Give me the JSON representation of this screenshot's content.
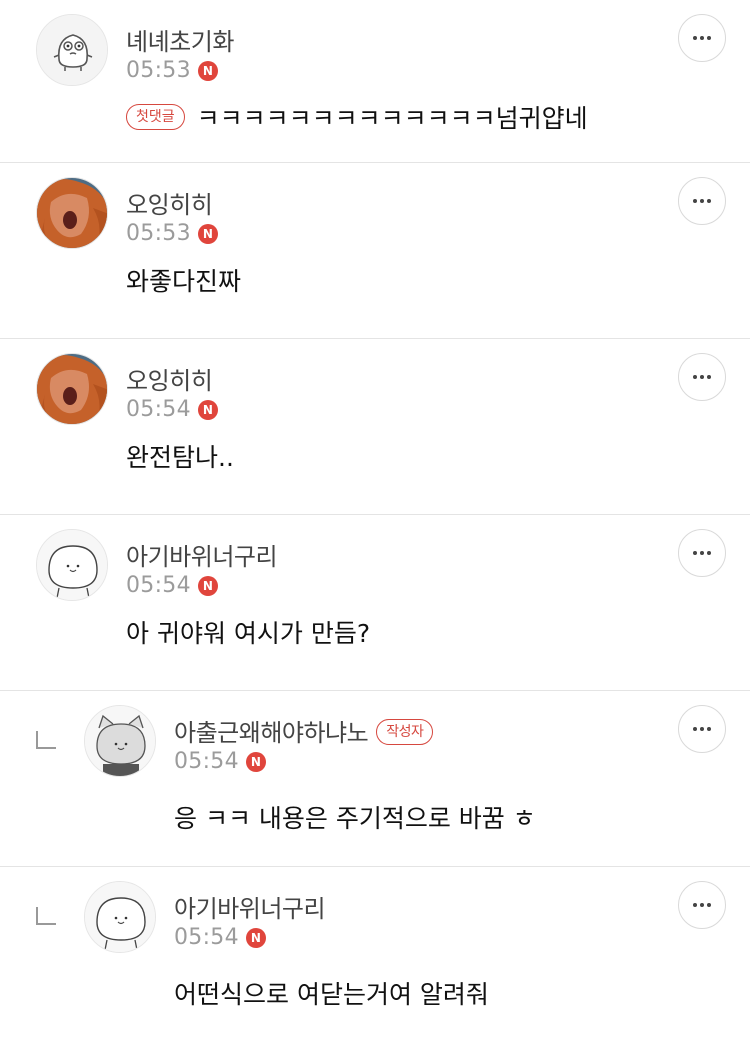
{
  "comments": [
    {
      "name": "녜녜초기화",
      "time": "05:53",
      "new_badge": "N",
      "tag": "첫댓글",
      "text": "ㅋㅋㅋㅋㅋㅋㅋㅋㅋㅋㅋㅋㅋ넘귀얍네",
      "avatar": "cartoon-character-icon"
    },
    {
      "name": "오잉히히",
      "time": "05:53",
      "new_badge": "N",
      "text": "와좋다진짜",
      "avatar": "orange-hair-photo"
    },
    {
      "name": "오잉히히",
      "time": "05:54",
      "new_badge": "N",
      "text": "완전탐나..",
      "avatar": "orange-hair-photo"
    },
    {
      "name": "아기바위너구리",
      "time": "05:54",
      "new_badge": "N",
      "text": "아 귀야워 여시가 만듬?",
      "avatar": "white-blob-character"
    },
    {
      "name": "아출근왜해야하냐노",
      "time": "05:54",
      "new_badge": "N",
      "author_tag": "작성자",
      "text": "응 ㅋㅋ 내용은 주기적으로 바꿈 ㅎ",
      "reply": true,
      "avatar": "gray-cat-character"
    },
    {
      "name": "아기바위너구리",
      "time": "05:54",
      "new_badge": "N",
      "text": "어떤식으로 여닫는거여 알려줘",
      "reply": true,
      "avatar": "white-blob-character"
    }
  ],
  "colors": {
    "badge": "#e0453c",
    "tag": "#d6483f",
    "divider": "#e4e4e4"
  }
}
